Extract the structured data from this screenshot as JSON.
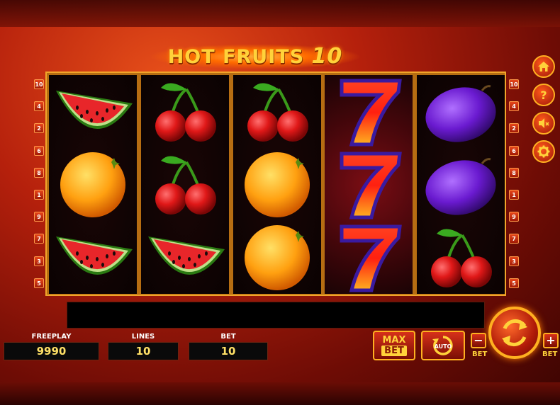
{
  "title": {
    "main": "HOT FRUITS",
    "number": "10"
  },
  "reels": [
    [
      "watermelon-icon",
      "orange-icon",
      "watermelon-icon"
    ],
    [
      "cherry-icon",
      "cherry-icon",
      "watermelon-icon"
    ],
    [
      "cherry-icon",
      "orange-icon",
      "orange-icon"
    ],
    [
      "seven-icon",
      "seven-icon",
      "seven-icon"
    ],
    [
      "plum-icon",
      "plum-icon",
      "cherry-icon"
    ]
  ],
  "paylines_left": [
    "10",
    "4",
    "2",
    "6",
    "8",
    "1",
    "9",
    "7",
    "3",
    "5"
  ],
  "paylines_right": [
    "10",
    "4",
    "2",
    "6",
    "8",
    "1",
    "9",
    "7",
    "3",
    "5"
  ],
  "stats": {
    "freeplay_label": "FREEPLAY",
    "freeplay_value": "9990",
    "lines_label": "LINES",
    "lines_value": "10",
    "bet_label": "BET",
    "bet_value": "10"
  },
  "buttons": {
    "max_bet_1": "MAX",
    "max_bet_2": "BET",
    "auto": "AUTO",
    "bet_minus_label": "BET",
    "bet_plus_label": "BET",
    "minus": "−",
    "plus": "+"
  },
  "side_icons": [
    "home-icon",
    "help-icon",
    "sound-off-icon",
    "settings-icon"
  ],
  "colors": {
    "accent": "#ffb020",
    "gold": "#ffd23a",
    "bg": "#b5200c"
  }
}
